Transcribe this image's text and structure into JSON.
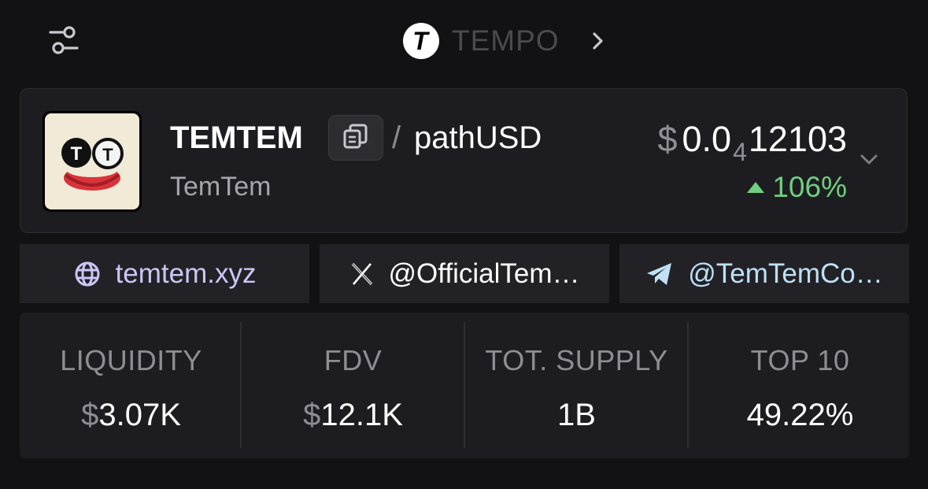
{
  "header": {
    "filter_icon": "sliders-icon",
    "chain": {
      "logo_letter": "T",
      "name": "TEMPO",
      "chevron_icon": "chevron-right-icon"
    }
  },
  "token": {
    "symbol": "TEMTEM",
    "copy_icon": "copy-icon",
    "pair_separator": "/",
    "quote": "pathUSD",
    "name": "TemTem",
    "price": {
      "currency": "$",
      "prefix": "0.0",
      "zero_count": "4",
      "digits": "12103"
    },
    "change": {
      "direction": "up",
      "value": "106%",
      "color": "#6fcf7f"
    },
    "expand_icon": "chevron-down-icon"
  },
  "links": [
    {
      "icon": "globe-icon",
      "text": "temtem.xyz",
      "color": "#cbc6f5"
    },
    {
      "icon": "x-icon",
      "text": "@OfficialTem…",
      "color": "#ffffff"
    },
    {
      "icon": "telegram-icon",
      "text": "@TemTemCo…",
      "color": "#bfe0f5"
    }
  ],
  "stats": [
    {
      "label": "LIQUIDITY",
      "currency": "$",
      "value": "3.07K"
    },
    {
      "label": "FDV",
      "currency": "$",
      "value": "12.1K"
    },
    {
      "label": "TOT. SUPPLY",
      "currency": "",
      "value": "1B"
    },
    {
      "label": "TOP 10",
      "currency": "",
      "value": "49.22%"
    }
  ]
}
